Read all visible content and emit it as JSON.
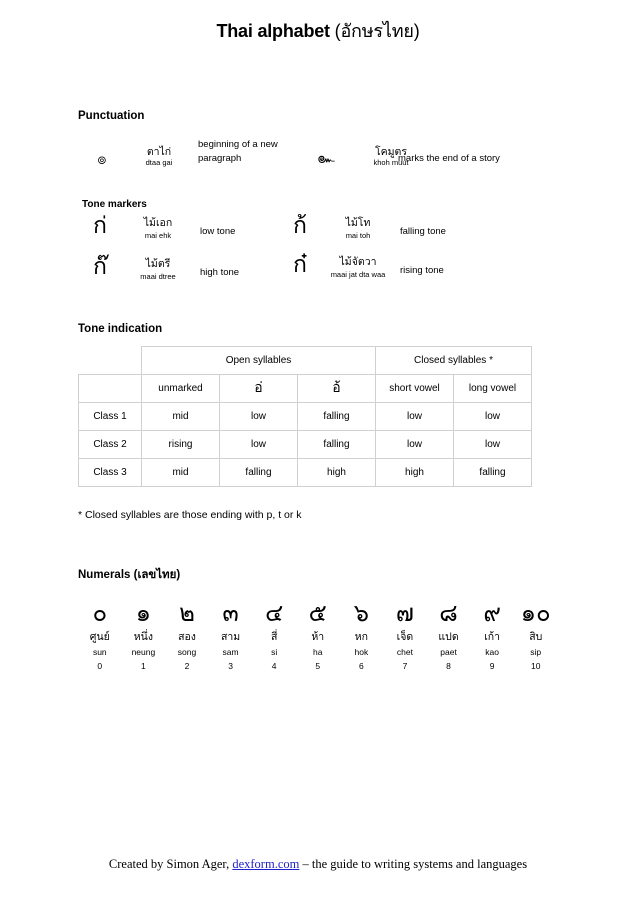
{
  "title": {
    "latin": "Thai alphabet ",
    "thai": "(อักษรไทย)"
  },
  "sections": {
    "punctuation_heading": "Punctuation",
    "tone_markers_heading": "Tone markers",
    "tone_indication_heading": "Tone indication",
    "numerals_heading": "Numerals ",
    "numerals_heading_thai": "(เลขไทย)"
  },
  "punctuation": [
    {
      "glyph": "๏",
      "icon": "fongman-symbol",
      "thai_name": "ตาไก่",
      "roman_name": "dtaa gai",
      "description": "beginning of a new paragraph"
    },
    {
      "glyph": "๛",
      "icon": "khomut-symbol",
      "thai_name": "โคมูตร",
      "roman_name": "khoh muut",
      "description": "marks the end of a story"
    }
  ],
  "tone_markers": [
    {
      "glyph": "ก่",
      "thai_name": "ไม้เอก",
      "roman_name": "mai ehk",
      "tone": "low tone"
    },
    {
      "glyph": "ก้",
      "thai_name": "ไม้โท",
      "roman_name": "mai toh",
      "tone": "falling tone"
    },
    {
      "glyph": "ก๊",
      "thai_name": "ไม้ตรี",
      "roman_name": "maai dtree",
      "tone": "high tone"
    },
    {
      "glyph": "ก๋",
      "thai_name": "ไม้จัตวา",
      "roman_name": "maai jat dta waa",
      "tone": "rising tone"
    }
  ],
  "tone_table": {
    "group_headers": [
      "Open syllables",
      "Closed syllables *"
    ],
    "column_headers": [
      "unmarked",
      "อ่",
      "อ้",
      "short vowel",
      "long vowel"
    ],
    "rows": [
      {
        "label": "Class 1",
        "cells": [
          "mid",
          "low",
          "falling",
          "low",
          "low"
        ]
      },
      {
        "label": "Class 2",
        "cells": [
          "rising",
          "low",
          "falling",
          "low",
          "low"
        ]
      },
      {
        "label": "Class 3",
        "cells": [
          "mid",
          "falling",
          "high",
          "high",
          "falling"
        ]
      }
    ],
    "note": "* Closed syllables are those ending with p, t or k"
  },
  "numerals": [
    {
      "glyph": "๐",
      "thai": "ศูนย์",
      "roman": "sun",
      "value": "0"
    },
    {
      "glyph": "๑",
      "thai": "หนึ่ง",
      "roman": "neung",
      "value": "1"
    },
    {
      "glyph": "๒",
      "thai": "สอง",
      "roman": "song",
      "value": "2"
    },
    {
      "glyph": "๓",
      "thai": "สาม",
      "roman": "sam",
      "value": "3"
    },
    {
      "glyph": "๔",
      "thai": "สี่",
      "roman": "si",
      "value": "4"
    },
    {
      "glyph": "๕",
      "thai": "ห้า",
      "roman": "ha",
      "value": "5"
    },
    {
      "glyph": "๖",
      "thai": "หก",
      "roman": "hok",
      "value": "6"
    },
    {
      "glyph": "๗",
      "thai": "เจ็ด",
      "roman": "chet",
      "value": "7"
    },
    {
      "glyph": "๘",
      "thai": "แปด",
      "roman": "paet",
      "value": "8"
    },
    {
      "glyph": "๙",
      "thai": "เก้า",
      "roman": "kao",
      "value": "9"
    },
    {
      "glyph": "๑๐",
      "thai": "สิบ",
      "roman": "sip",
      "value": "10"
    }
  ],
  "footer": {
    "before_link": "Created by Simon Ager, ",
    "link_text": "dexform.com",
    "after_link": " – the guide to writing systems and languages",
    "link_color": "#2222cc"
  }
}
